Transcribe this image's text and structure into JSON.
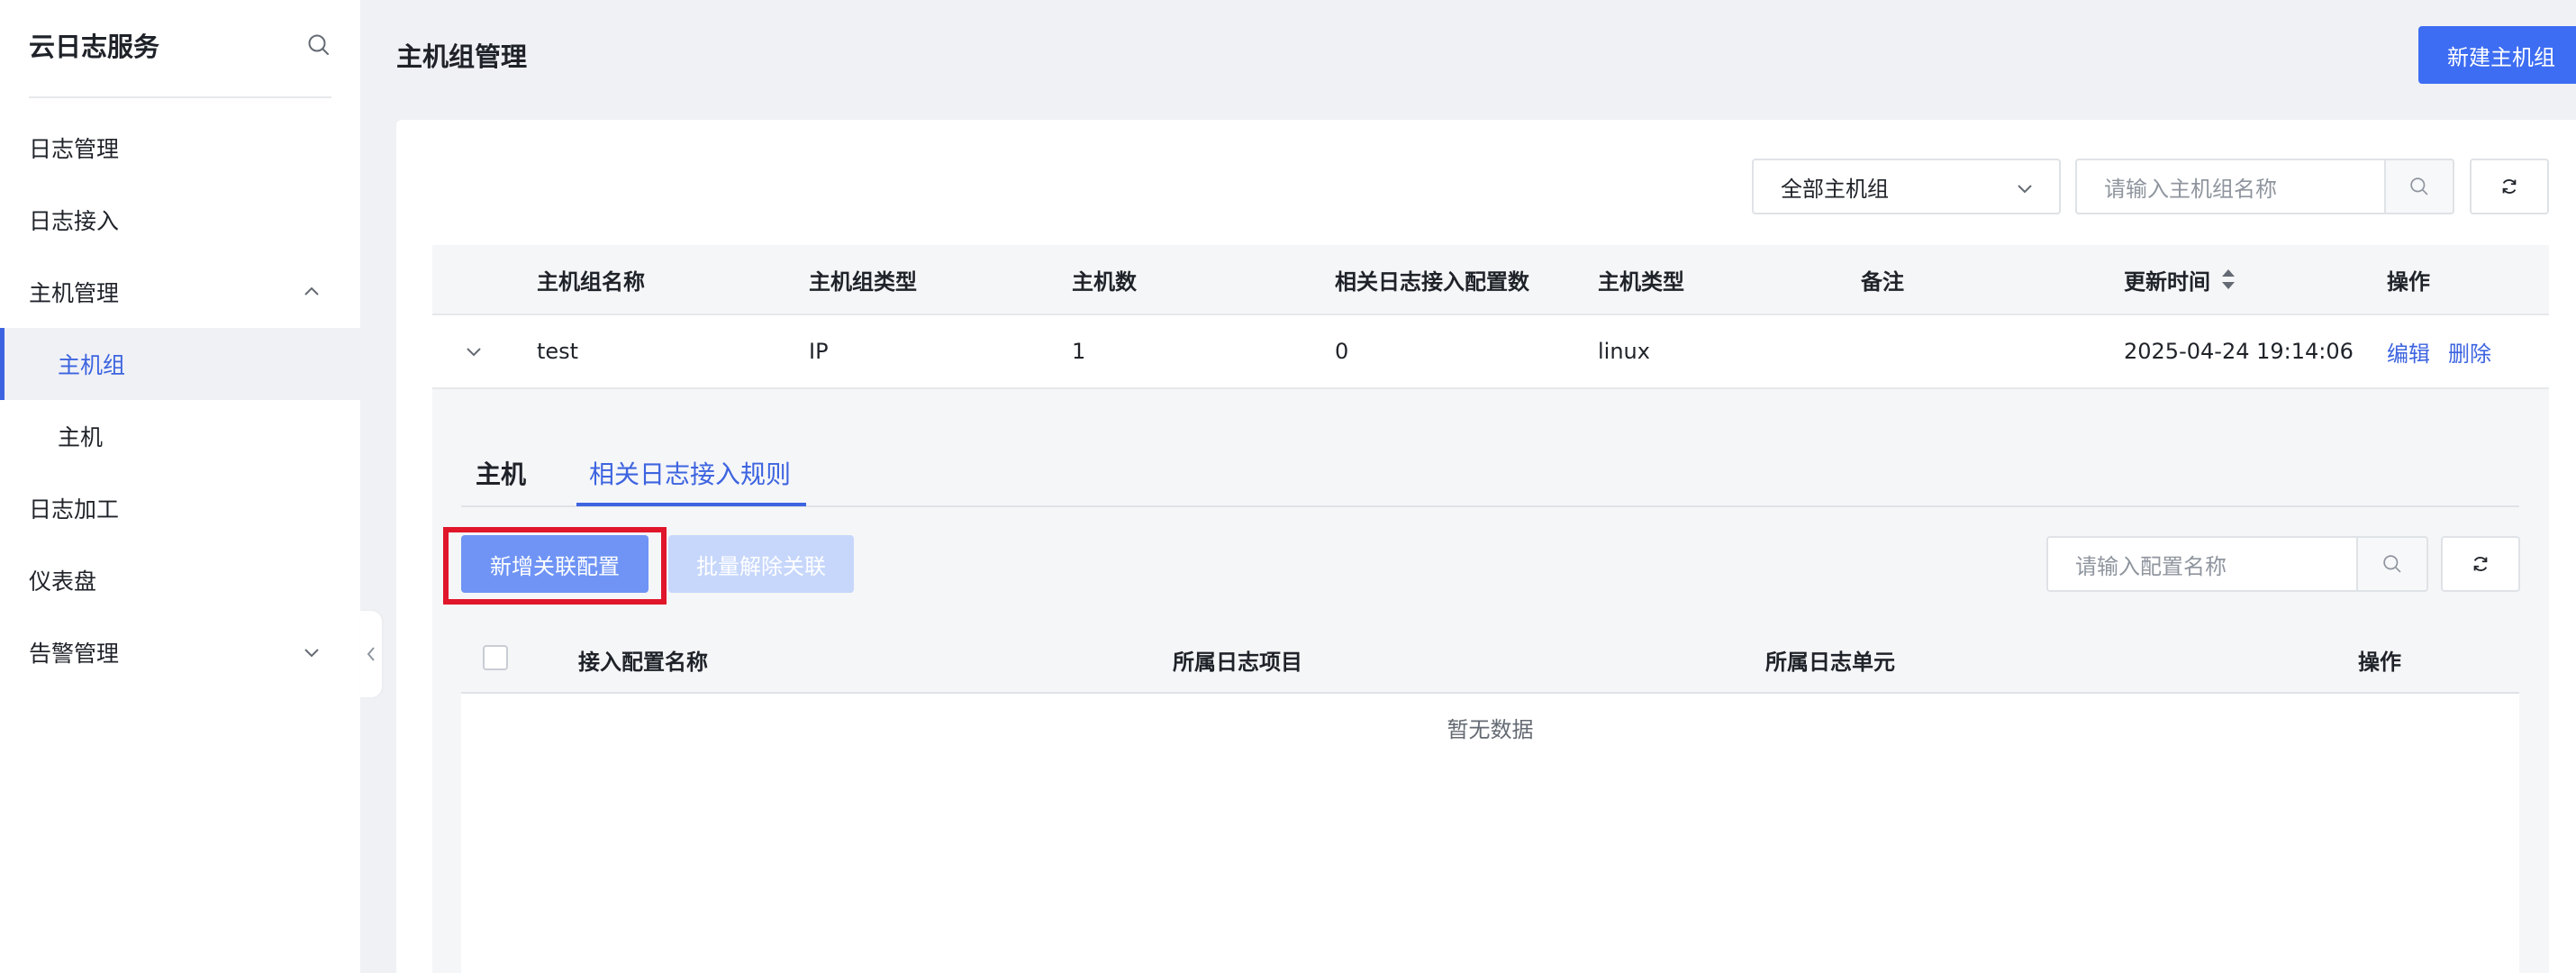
{
  "sidebar": {
    "title": "云日志服务",
    "items": [
      {
        "label": "日志管理"
      },
      {
        "label": "日志接入"
      },
      {
        "label": "主机管理"
      },
      {
        "label": "主机组"
      },
      {
        "label": "主机"
      },
      {
        "label": "日志加工"
      },
      {
        "label": "仪表盘"
      },
      {
        "label": "告警管理"
      }
    ]
  },
  "header": {
    "title": "主机组管理",
    "new_button": "新建主机组"
  },
  "filters": {
    "select_value": "全部主机组",
    "search_placeholder": "请输入主机组名称"
  },
  "table": {
    "columns": [
      "主机组名称",
      "主机组类型",
      "主机数",
      "相关日志接入配置数",
      "主机类型",
      "备注",
      "更新时间",
      "操作"
    ],
    "rows": [
      {
        "name": "test",
        "type": "IP",
        "host_count": "1",
        "config_count": "0",
        "host_type": "linux",
        "remark": "",
        "updated": "2025-04-24 19:14:06",
        "edit": "编辑",
        "delete": "删除"
      }
    ]
  },
  "detail": {
    "tabs": [
      "主机",
      "相关日志接入规则"
    ],
    "add_button": "新增关联配置",
    "batch_button": "批量解除关联",
    "search_placeholder": "请输入配置名称",
    "columns": [
      "接入配置名称",
      "所属日志项目",
      "所属日志单元",
      "操作"
    ],
    "empty_text": "暂无数据"
  },
  "colors": {
    "primary": "#3d6df2",
    "link": "#3d64e0",
    "highlight": "#e0162b"
  }
}
